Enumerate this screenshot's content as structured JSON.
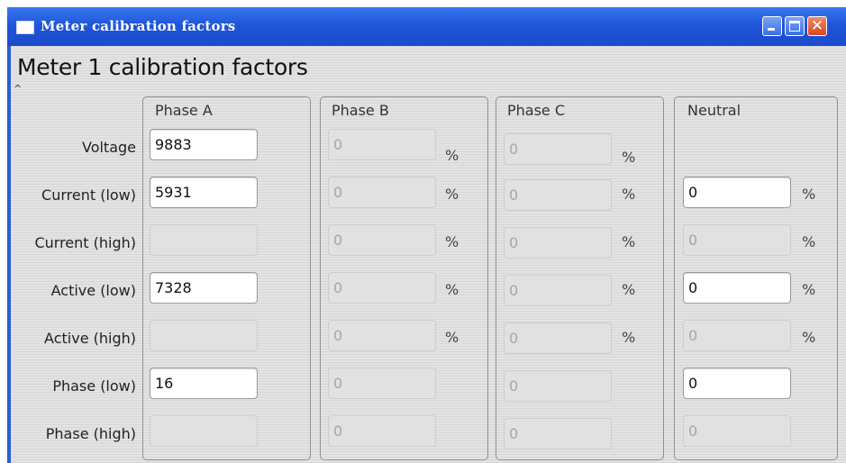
{
  "window": {
    "title": "Meter calibration factors"
  },
  "heading": "Meter 1 calibration factors",
  "rows": [
    "Voltage",
    "Current (low)",
    "Current (high)",
    "Active (low)",
    "Active (high)",
    "Phase (low)",
    "Phase (high)"
  ],
  "groups": [
    {
      "title": "Phase A"
    },
    {
      "title": "Phase B"
    },
    {
      "title": "Phase C"
    },
    {
      "title": "Neutral"
    }
  ],
  "fields": {
    "phase_a": {
      "voltage": {
        "value": "9883",
        "enabled": true
      },
      "current_low": {
        "value": "5931",
        "enabled": true
      },
      "current_high": {
        "value": "",
        "enabled": false
      },
      "active_low": {
        "value": "7328",
        "enabled": true
      },
      "active_high": {
        "value": "",
        "enabled": false
      },
      "phase_low": {
        "value": "16",
        "enabled": true
      },
      "phase_high": {
        "value": "",
        "enabled": false
      }
    },
    "phase_b": {
      "voltage": {
        "value": "0",
        "enabled": false,
        "unit": "%"
      },
      "current_low": {
        "value": "0",
        "enabled": false,
        "unit": "%"
      },
      "current_high": {
        "value": "0",
        "enabled": false,
        "unit": "%"
      },
      "active_low": {
        "value": "0",
        "enabled": false,
        "unit": "%"
      },
      "active_high": {
        "value": "0",
        "enabled": false,
        "unit": "%"
      },
      "phase_low": {
        "value": "0",
        "enabled": false
      },
      "phase_high": {
        "value": "0",
        "enabled": false
      }
    },
    "phase_c": {
      "voltage": {
        "value": "0",
        "enabled": false,
        "unit": "%"
      },
      "current_low": {
        "value": "0",
        "enabled": false,
        "unit": "%"
      },
      "current_high": {
        "value": "0",
        "enabled": false,
        "unit": "%"
      },
      "active_low": {
        "value": "0",
        "enabled": false,
        "unit": "%"
      },
      "active_high": {
        "value": "0",
        "enabled": false,
        "unit": "%"
      },
      "phase_low": {
        "value": "0",
        "enabled": false
      },
      "phase_high": {
        "value": "0",
        "enabled": false
      }
    },
    "neutral": {
      "current_low": {
        "value": "0",
        "enabled": true,
        "unit": "%"
      },
      "current_high": {
        "value": "0",
        "enabled": false,
        "unit": "%"
      },
      "active_low": {
        "value": "0",
        "enabled": true,
        "unit": "%"
      },
      "active_high": {
        "value": "0",
        "enabled": false,
        "unit": "%"
      },
      "phase_low": {
        "value": "0",
        "enabled": true
      },
      "phase_high": {
        "value": "0",
        "enabled": false
      }
    }
  },
  "unit_symbol": "%",
  "colors": {
    "titlebar": "#1f55d9",
    "close_button": "#d6461f",
    "client_bg": "#e3e3e3"
  }
}
